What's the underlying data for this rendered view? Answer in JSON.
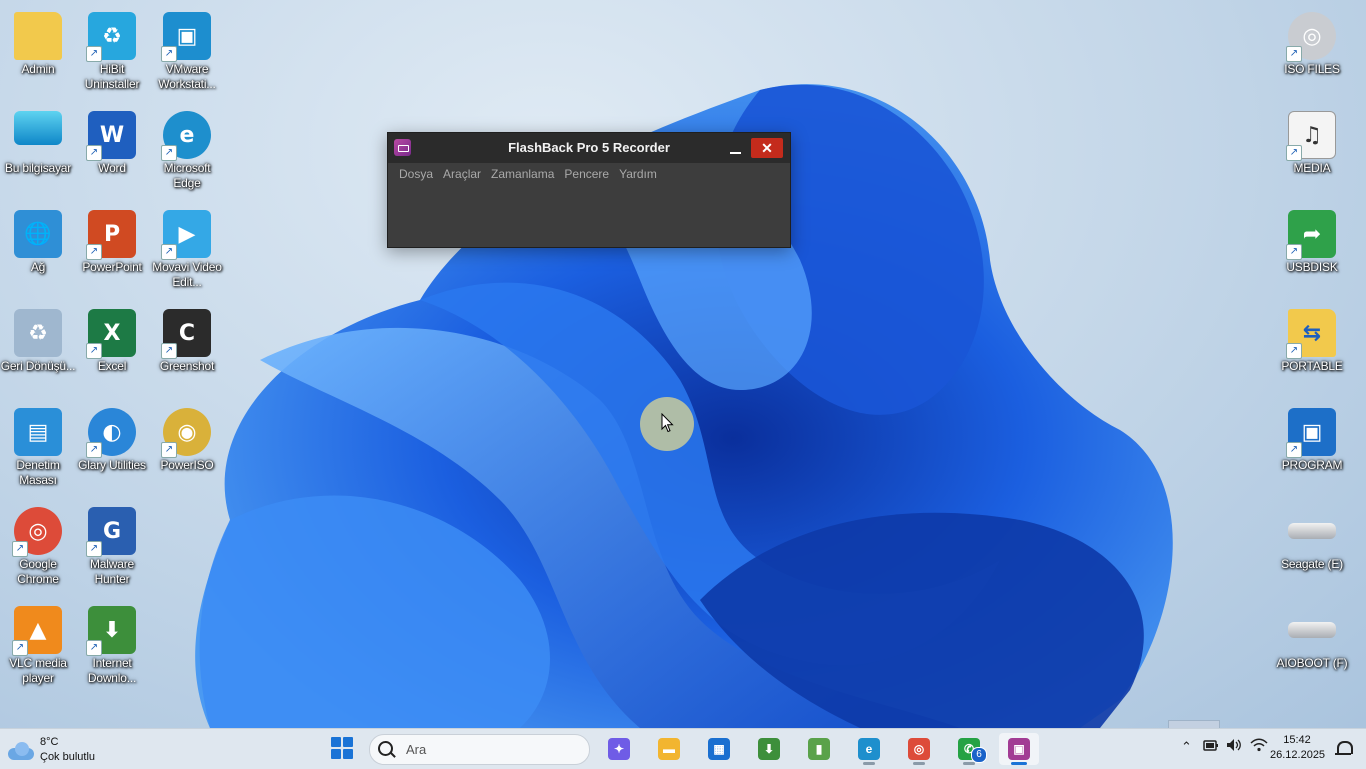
{
  "desktop": {
    "icons": [
      {
        "label": "Admin",
        "icon": "folder-icon",
        "glyph": "",
        "color": "#f2c94c",
        "shortcut": false
      },
      {
        "label": "HiBit Uninstaller",
        "icon": "recycle-uninstaller-icon",
        "glyph": "♻",
        "color": "#27a7de",
        "shortcut": true
      },
      {
        "label": "VMware Workstati...",
        "icon": "vmware-icon",
        "glyph": "▣",
        "color": "#1d8ecf",
        "shortcut": true
      },
      {
        "label": "Bu bilgisayar",
        "icon": "monitor-icon",
        "glyph": "",
        "color": "#1bb2d8",
        "shortcut": false
      },
      {
        "label": "Word",
        "icon": "word-icon",
        "glyph": "W",
        "color": "#1f5fbf",
        "shortcut": true
      },
      {
        "label": "Microsoft Edge",
        "icon": "edge-icon",
        "glyph": "e",
        "color": "#1e8fcd",
        "shortcut": true
      },
      {
        "label": "Ağ",
        "icon": "network-icon",
        "glyph": "🌐",
        "color": "#2f8fd6",
        "shortcut": false
      },
      {
        "label": "PowerPoint",
        "icon": "powerpoint-icon",
        "glyph": "P",
        "color": "#d04a22",
        "shortcut": true
      },
      {
        "label": "Movavi Video Edit...",
        "icon": "movavi-icon",
        "glyph": "▶",
        "color": "#34a8e6",
        "shortcut": true
      },
      {
        "label": "Geri Dönüşü...",
        "icon": "recycle-bin-icon",
        "glyph": "♻",
        "color": "#9fb7cf",
        "shortcut": false
      },
      {
        "label": "Excel",
        "icon": "excel-icon",
        "glyph": "X",
        "color": "#1d7a45",
        "shortcut": true
      },
      {
        "label": "Greenshot",
        "icon": "greenshot-icon",
        "glyph": "C",
        "color": "#2b2b2b",
        "shortcut": true
      },
      {
        "label": "Denetim Masası",
        "icon": "control-panel-icon",
        "glyph": "▤",
        "color": "#2a8fd8",
        "shortcut": false
      },
      {
        "label": "Glary Utilities",
        "icon": "glary-icon",
        "glyph": "◐",
        "color": "#2a86d8",
        "shortcut": true
      },
      {
        "label": "PowerISO",
        "icon": "poweriso-icon",
        "glyph": "◉",
        "color": "#d9b13a",
        "shortcut": true
      },
      {
        "label": "Google Chrome",
        "icon": "chrome-icon",
        "glyph": "◎",
        "color": "#dd4b39",
        "shortcut": true
      },
      {
        "label": "Malware Hunter",
        "icon": "malware-hunter-icon",
        "glyph": "G",
        "color": "#2a5fb0",
        "shortcut": true
      },
      {
        "label": "VLC media player",
        "icon": "vlc-icon",
        "glyph": "▲",
        "color": "#f08a1c",
        "shortcut": true
      },
      {
        "label": "Internet Downlo...",
        "icon": "idm-icon",
        "glyph": "⬇",
        "color": "#3d8f3b",
        "shortcut": true
      },
      {
        "label": "ISO FILES",
        "icon": "disc-icon",
        "glyph": "◎",
        "color": "#c9ccd1",
        "shortcut": true
      },
      {
        "label": "MEDIA",
        "icon": "music-file-icon",
        "glyph": "♫",
        "color": "#f4f4f4",
        "shortcut": true
      },
      {
        "label": "USBDISK",
        "icon": "usb-share-icon",
        "glyph": "➦",
        "color": "#2fa14a",
        "shortcut": true
      },
      {
        "label": "PORTABLE",
        "icon": "portable-folder-icon",
        "glyph": "⇆",
        "color": "#f2c94c",
        "shortcut": true
      },
      {
        "label": "PROGRAM",
        "icon": "program-window-icon",
        "glyph": "▣",
        "color": "#1d6fc8",
        "shortcut": true
      },
      {
        "label": "Seagate (E)",
        "icon": "drive-icon",
        "glyph": "",
        "color": "#d5d8dc",
        "shortcut": false
      },
      {
        "label": "AIOBOOT (F)",
        "icon": "drive-icon",
        "glyph": "",
        "color": "#d5d8dc",
        "shortcut": false
      }
    ]
  },
  "window": {
    "title": "FlashBack Pro 5 Recorder",
    "close_label": "✕",
    "menu": [
      "Dosya",
      "Araçlar",
      "Zamanlama",
      "Pencere",
      "Yardım"
    ]
  },
  "taskbar": {
    "weather": {
      "temp": "8°C",
      "desc": "Çok bulutlu"
    },
    "search_placeholder": "Ara",
    "apps": [
      {
        "name": "copilot",
        "glyph": "✦",
        "color": "#6f5ce6"
      },
      {
        "name": "file-explorer",
        "glyph": "▬",
        "color": "#f2b530"
      },
      {
        "name": "microsoft-store",
        "glyph": "▦",
        "color": "#1a6fd0"
      },
      {
        "name": "internet-download-manager",
        "glyph": "⬇",
        "color": "#3d8f3b"
      },
      {
        "name": "notepad-chart",
        "glyph": "▮",
        "color": "#5aa24a"
      },
      {
        "name": "edge",
        "glyph": "e",
        "color": "#1e8fcd"
      },
      {
        "name": "chrome",
        "glyph": "◎",
        "color": "#dd4b39"
      },
      {
        "name": "whatsapp",
        "glyph": "✆",
        "color": "#25a244",
        "badge": "6"
      },
      {
        "name": "flashback-recorder",
        "glyph": "▣",
        "color": "#a23c94",
        "active": true
      }
    ],
    "clock": {
      "time": "15:42",
      "date": "26.12.2025"
    }
  }
}
